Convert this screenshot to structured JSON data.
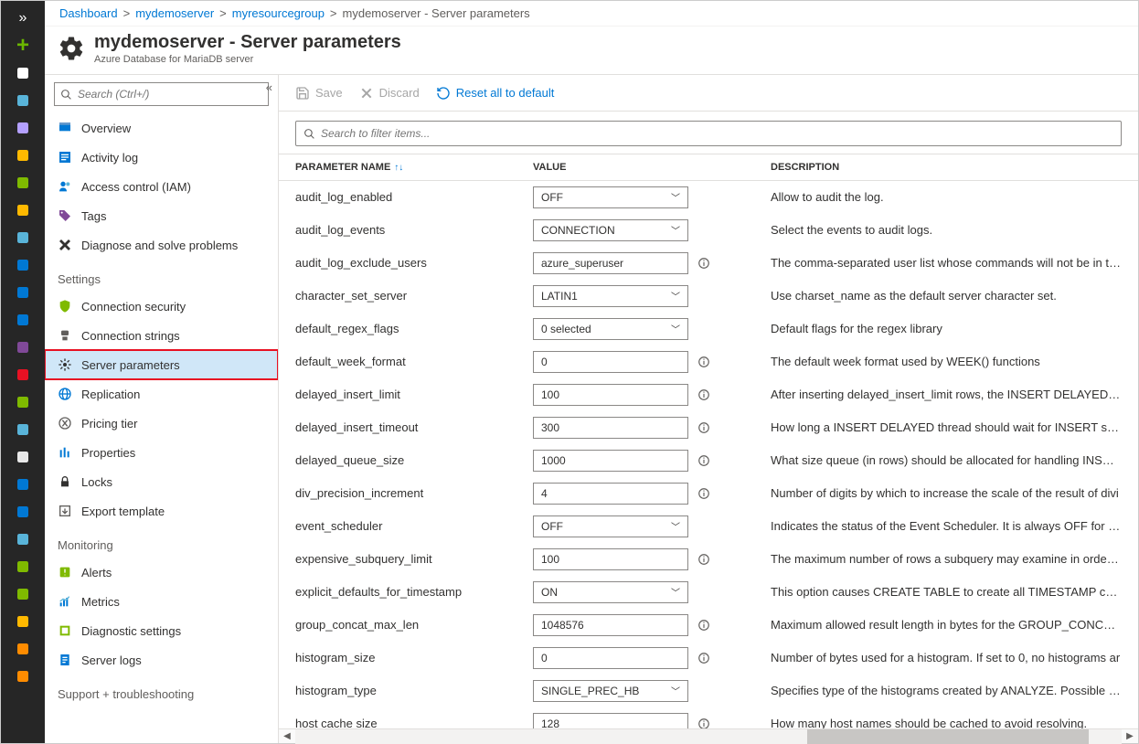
{
  "breadcrumb": [
    {
      "label": "Dashboard",
      "link": true
    },
    {
      "label": "mydemoserver",
      "link": true
    },
    {
      "label": "myresourcegroup",
      "link": true
    },
    {
      "label": "mydemoserver - Server parameters",
      "link": false
    }
  ],
  "title": "mydemoserver - Server parameters",
  "subtitle": "Azure Database for MariaDB server",
  "sidebar": {
    "search_placeholder": "Search (Ctrl+/)",
    "groups": [
      {
        "label": null,
        "items": [
          {
            "label": "Overview",
            "icon": "overview",
            "selected": false
          },
          {
            "label": "Activity log",
            "icon": "activity",
            "selected": false
          },
          {
            "label": "Access control (IAM)",
            "icon": "iam",
            "selected": false
          },
          {
            "label": "Tags",
            "icon": "tags",
            "selected": false
          },
          {
            "label": "Diagnose and solve problems",
            "icon": "diagnose",
            "selected": false
          }
        ]
      },
      {
        "label": "Settings",
        "items": [
          {
            "label": "Connection security",
            "icon": "shield",
            "selected": false
          },
          {
            "label": "Connection strings",
            "icon": "conn",
            "selected": false
          },
          {
            "label": "Server parameters",
            "icon": "gear",
            "selected": true
          },
          {
            "label": "Replication",
            "icon": "globe",
            "selected": false
          },
          {
            "label": "Pricing tier",
            "icon": "pricing",
            "selected": false
          },
          {
            "label": "Properties",
            "icon": "props",
            "selected": false
          },
          {
            "label": "Locks",
            "icon": "lock",
            "selected": false
          },
          {
            "label": "Export template",
            "icon": "export",
            "selected": false
          }
        ]
      },
      {
        "label": "Monitoring",
        "items": [
          {
            "label": "Alerts",
            "icon": "alerts",
            "selected": false
          },
          {
            "label": "Metrics",
            "icon": "metrics",
            "selected": false
          },
          {
            "label": "Diagnostic settings",
            "icon": "diag",
            "selected": false
          },
          {
            "label": "Server logs",
            "icon": "logs",
            "selected": false
          }
        ]
      },
      {
        "label": "Support + troubleshooting",
        "items": []
      }
    ]
  },
  "toolbar": {
    "save": "Save",
    "discard": "Discard",
    "reset": "Reset all to default"
  },
  "filter_placeholder": "Search to filter items...",
  "columns": {
    "name": "Parameter Name",
    "value": "Value",
    "description": "Description"
  },
  "parameters": [
    {
      "name": "audit_log_enabled",
      "value": "OFF",
      "type": "select",
      "info": false,
      "desc": "Allow to audit the log."
    },
    {
      "name": "audit_log_events",
      "value": "CONNECTION",
      "type": "select",
      "info": false,
      "desc": "Select the events to audit logs."
    },
    {
      "name": "audit_log_exclude_users",
      "value": "azure_superuser",
      "type": "text",
      "info": true,
      "desc": "The comma-separated user list whose commands will not be in the"
    },
    {
      "name": "character_set_server",
      "value": "LATIN1",
      "type": "select",
      "info": false,
      "desc": "Use charset_name as the default server character set."
    },
    {
      "name": "default_regex_flags",
      "value": "0 selected",
      "type": "select",
      "info": false,
      "desc": "Default flags for the regex library"
    },
    {
      "name": "default_week_format",
      "value": "0",
      "type": "text",
      "info": true,
      "desc": "The default week format used by WEEK() functions"
    },
    {
      "name": "delayed_insert_limit",
      "value": "100",
      "type": "text",
      "info": true,
      "desc": "After inserting delayed_insert_limit rows, the INSERT DELAYED hand"
    },
    {
      "name": "delayed_insert_timeout",
      "value": "300",
      "type": "text",
      "info": true,
      "desc": "How long a INSERT DELAYED thread should wait for INSERT statem"
    },
    {
      "name": "delayed_queue_size",
      "value": "1000",
      "type": "text",
      "info": true,
      "desc": "What size queue (in rows) should be allocated for handling INSERT"
    },
    {
      "name": "div_precision_increment",
      "value": "4",
      "type": "text",
      "info": true,
      "desc": "Number of digits by which to increase the scale of the result of divi"
    },
    {
      "name": "event_scheduler",
      "value": "OFF",
      "type": "select",
      "info": false,
      "desc": "Indicates the status of the Event Scheduler. It is always OFF for a rep"
    },
    {
      "name": "expensive_subquery_limit",
      "value": "100",
      "type": "text",
      "info": true,
      "desc": "The maximum number of rows a subquery may examine in order to"
    },
    {
      "name": "explicit_defaults_for_timestamp",
      "value": "ON",
      "type": "select",
      "info": false,
      "desc": "This option causes CREATE TABLE to create all TIMESTAMP columns"
    },
    {
      "name": "group_concat_max_len",
      "value": "1048576",
      "type": "text",
      "info": true,
      "desc": "Maximum allowed result length in bytes for the GROUP_CONCAT()."
    },
    {
      "name": "histogram_size",
      "value": "0",
      "type": "text",
      "info": true,
      "desc": "Number of bytes used for a histogram. If set to 0, no histograms ar"
    },
    {
      "name": "histogram_type",
      "value": "SINGLE_PREC_HB",
      "type": "select",
      "info": false,
      "desc": "Specifies type of the histograms created by ANALYZE. Possible valu"
    },
    {
      "name": "host cache size",
      "value": "128",
      "type": "text",
      "info": true,
      "desc": "How many host names should be cached to avoid resolving."
    }
  ],
  "rail_colors": [
    "#fff",
    "#59b4d9",
    "#b4a0ff",
    "#ffb900",
    "#7fba00",
    "#ffb900",
    "#59b4d9",
    "#0078d4",
    "#0078d4",
    "#0078d4",
    "#804998",
    "#e81123",
    "#7fba00",
    "#59b4d9",
    "#e8e8e8",
    "#0078d4",
    "#0078d4",
    "#59b4d9",
    "#7fba00",
    "#7fba00",
    "#ffb900",
    "#ff8c00",
    "#ff8c00"
  ]
}
